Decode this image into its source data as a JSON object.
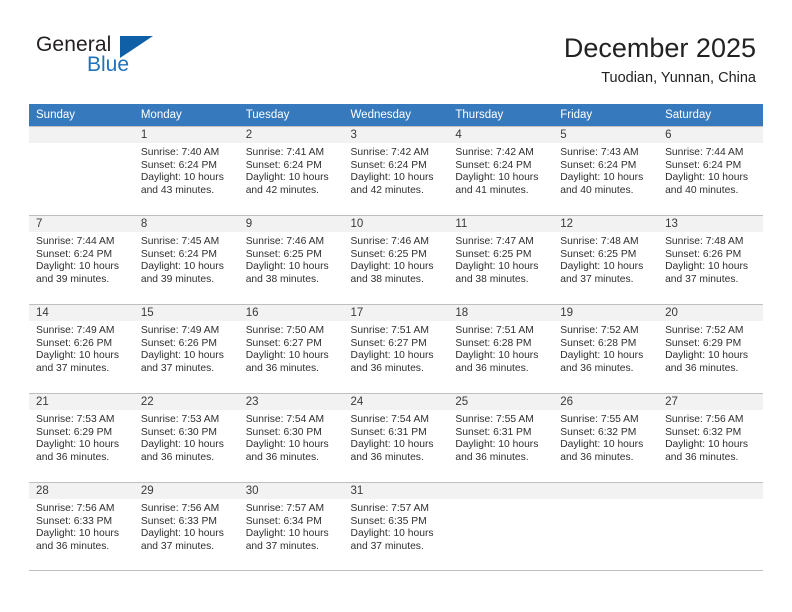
{
  "brand": {
    "name_top": "General",
    "name_bottom": "Blue",
    "flag_icon": "blue-triangle-flag-icon",
    "color_dark": "#231f20",
    "color_blue": "#1e73be"
  },
  "header": {
    "title": "December 2025",
    "subtitle": "Tuodian, Yunnan, China",
    "header_bg": "#3779bd",
    "header_text_color": "#ffffff"
  },
  "calendar": {
    "weekday_headers": [
      "Sunday",
      "Monday",
      "Tuesday",
      "Wednesday",
      "Thursday",
      "Friday",
      "Saturday"
    ],
    "labels": {
      "sunrise_prefix": "Sunrise:",
      "sunset_prefix": "Sunset:",
      "daylight_prefix": "Daylight:"
    },
    "weeks": [
      [
        {
          "day": "",
          "empty": true
        },
        {
          "day": "1",
          "sunrise": "Sunrise: 7:40 AM",
          "sunset": "Sunset: 6:24 PM",
          "daylight": "Daylight: 10 hours and 43 minutes."
        },
        {
          "day": "2",
          "sunrise": "Sunrise: 7:41 AM",
          "sunset": "Sunset: 6:24 PM",
          "daylight": "Daylight: 10 hours and 42 minutes."
        },
        {
          "day": "3",
          "sunrise": "Sunrise: 7:42 AM",
          "sunset": "Sunset: 6:24 PM",
          "daylight": "Daylight: 10 hours and 42 minutes."
        },
        {
          "day": "4",
          "sunrise": "Sunrise: 7:42 AM",
          "sunset": "Sunset: 6:24 PM",
          "daylight": "Daylight: 10 hours and 41 minutes."
        },
        {
          "day": "5",
          "sunrise": "Sunrise: 7:43 AM",
          "sunset": "Sunset: 6:24 PM",
          "daylight": "Daylight: 10 hours and 40 minutes."
        },
        {
          "day": "6",
          "sunrise": "Sunrise: 7:44 AM",
          "sunset": "Sunset: 6:24 PM",
          "daylight": "Daylight: 10 hours and 40 minutes."
        }
      ],
      [
        {
          "day": "7",
          "sunrise": "Sunrise: 7:44 AM",
          "sunset": "Sunset: 6:24 PM",
          "daylight": "Daylight: 10 hours and 39 minutes."
        },
        {
          "day": "8",
          "sunrise": "Sunrise: 7:45 AM",
          "sunset": "Sunset: 6:24 PM",
          "daylight": "Daylight: 10 hours and 39 minutes."
        },
        {
          "day": "9",
          "sunrise": "Sunrise: 7:46 AM",
          "sunset": "Sunset: 6:25 PM",
          "daylight": "Daylight: 10 hours and 38 minutes."
        },
        {
          "day": "10",
          "sunrise": "Sunrise: 7:46 AM",
          "sunset": "Sunset: 6:25 PM",
          "daylight": "Daylight: 10 hours and 38 minutes."
        },
        {
          "day": "11",
          "sunrise": "Sunrise: 7:47 AM",
          "sunset": "Sunset: 6:25 PM",
          "daylight": "Daylight: 10 hours and 38 minutes."
        },
        {
          "day": "12",
          "sunrise": "Sunrise: 7:48 AM",
          "sunset": "Sunset: 6:25 PM",
          "daylight": "Daylight: 10 hours and 37 minutes."
        },
        {
          "day": "13",
          "sunrise": "Sunrise: 7:48 AM",
          "sunset": "Sunset: 6:26 PM",
          "daylight": "Daylight: 10 hours and 37 minutes."
        }
      ],
      [
        {
          "day": "14",
          "sunrise": "Sunrise: 7:49 AM",
          "sunset": "Sunset: 6:26 PM",
          "daylight": "Daylight: 10 hours and 37 minutes."
        },
        {
          "day": "15",
          "sunrise": "Sunrise: 7:49 AM",
          "sunset": "Sunset: 6:26 PM",
          "daylight": "Daylight: 10 hours and 37 minutes."
        },
        {
          "day": "16",
          "sunrise": "Sunrise: 7:50 AM",
          "sunset": "Sunset: 6:27 PM",
          "daylight": "Daylight: 10 hours and 36 minutes."
        },
        {
          "day": "17",
          "sunrise": "Sunrise: 7:51 AM",
          "sunset": "Sunset: 6:27 PM",
          "daylight": "Daylight: 10 hours and 36 minutes."
        },
        {
          "day": "18",
          "sunrise": "Sunrise: 7:51 AM",
          "sunset": "Sunset: 6:28 PM",
          "daylight": "Daylight: 10 hours and 36 minutes."
        },
        {
          "day": "19",
          "sunrise": "Sunrise: 7:52 AM",
          "sunset": "Sunset: 6:28 PM",
          "daylight": "Daylight: 10 hours and 36 minutes."
        },
        {
          "day": "20",
          "sunrise": "Sunrise: 7:52 AM",
          "sunset": "Sunset: 6:29 PM",
          "daylight": "Daylight: 10 hours and 36 minutes."
        }
      ],
      [
        {
          "day": "21",
          "sunrise": "Sunrise: 7:53 AM",
          "sunset": "Sunset: 6:29 PM",
          "daylight": "Daylight: 10 hours and 36 minutes."
        },
        {
          "day": "22",
          "sunrise": "Sunrise: 7:53 AM",
          "sunset": "Sunset: 6:30 PM",
          "daylight": "Daylight: 10 hours and 36 minutes."
        },
        {
          "day": "23",
          "sunrise": "Sunrise: 7:54 AM",
          "sunset": "Sunset: 6:30 PM",
          "daylight": "Daylight: 10 hours and 36 minutes."
        },
        {
          "day": "24",
          "sunrise": "Sunrise: 7:54 AM",
          "sunset": "Sunset: 6:31 PM",
          "daylight": "Daylight: 10 hours and 36 minutes."
        },
        {
          "day": "25",
          "sunrise": "Sunrise: 7:55 AM",
          "sunset": "Sunset: 6:31 PM",
          "daylight": "Daylight: 10 hours and 36 minutes."
        },
        {
          "day": "26",
          "sunrise": "Sunrise: 7:55 AM",
          "sunset": "Sunset: 6:32 PM",
          "daylight": "Daylight: 10 hours and 36 minutes."
        },
        {
          "day": "27",
          "sunrise": "Sunrise: 7:56 AM",
          "sunset": "Sunset: 6:32 PM",
          "daylight": "Daylight: 10 hours and 36 minutes."
        }
      ],
      [
        {
          "day": "28",
          "sunrise": "Sunrise: 7:56 AM",
          "sunset": "Sunset: 6:33 PM",
          "daylight": "Daylight: 10 hours and 36 minutes."
        },
        {
          "day": "29",
          "sunrise": "Sunrise: 7:56 AM",
          "sunset": "Sunset: 6:33 PM",
          "daylight": "Daylight: 10 hours and 37 minutes."
        },
        {
          "day": "30",
          "sunrise": "Sunrise: 7:57 AM",
          "sunset": "Sunset: 6:34 PM",
          "daylight": "Daylight: 10 hours and 37 minutes."
        },
        {
          "day": "31",
          "sunrise": "Sunrise: 7:57 AM",
          "sunset": "Sunset: 6:35 PM",
          "daylight": "Daylight: 10 hours and 37 minutes."
        },
        {
          "day": "",
          "empty": true
        },
        {
          "day": "",
          "empty": true
        },
        {
          "day": "",
          "empty": true
        }
      ]
    ]
  }
}
